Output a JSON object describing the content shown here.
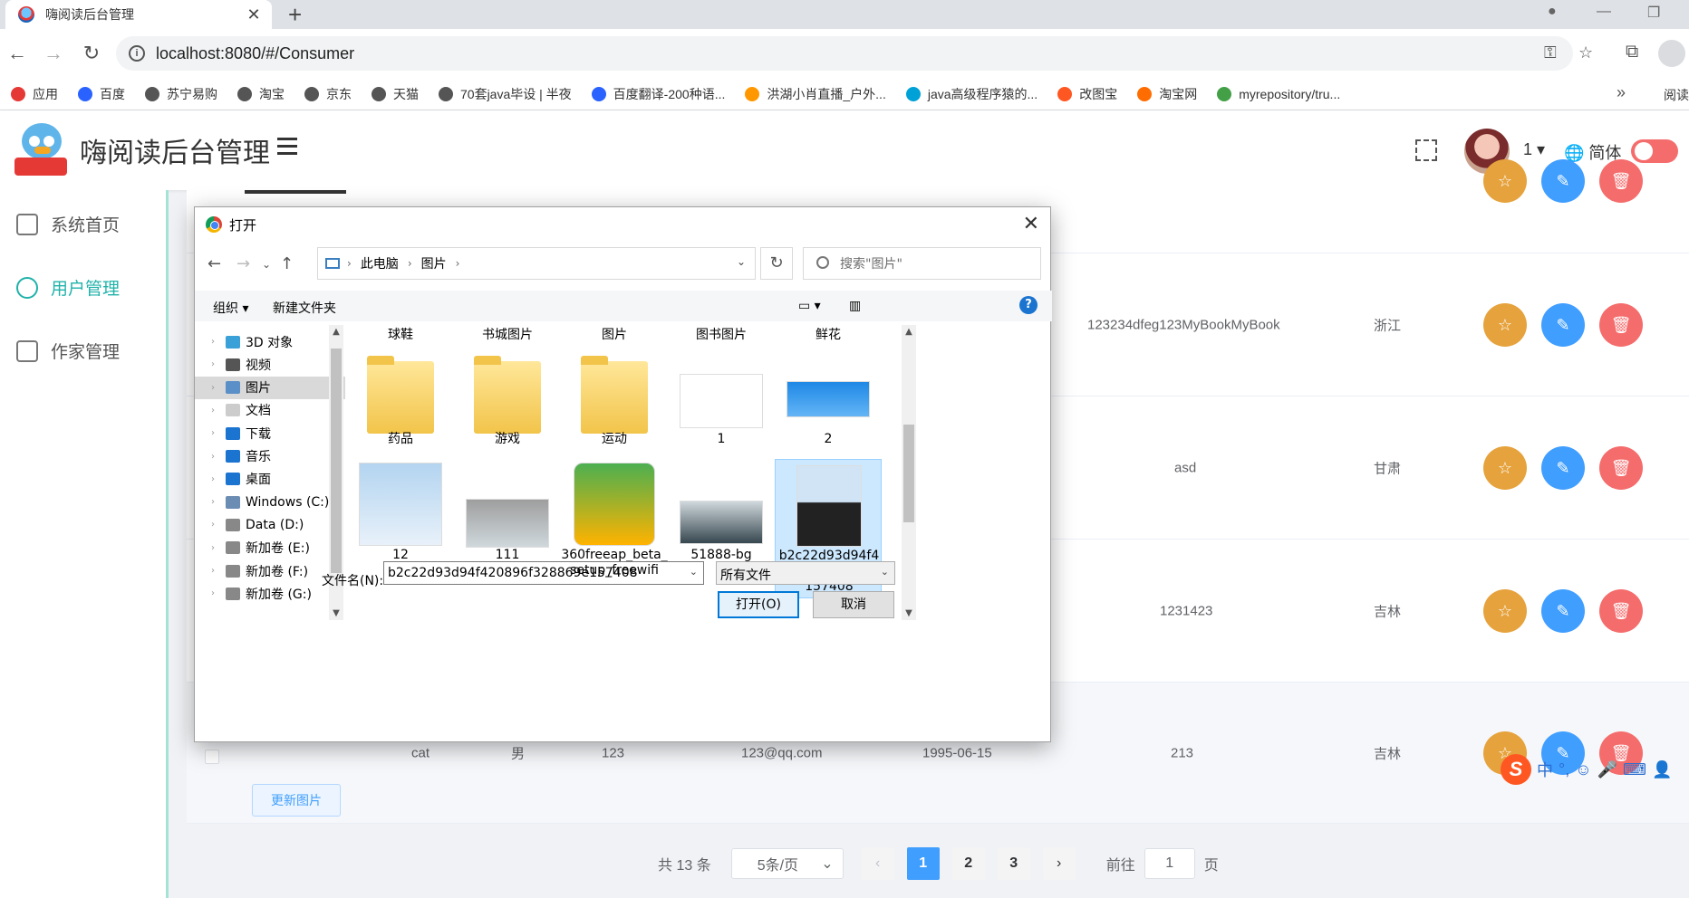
{
  "browser": {
    "tab_title": "嗨阅读后台管理",
    "url": "localhost:8080/#/Consumer",
    "bookmarks": [
      {
        "label": "应用",
        "color": "#e53935"
      },
      {
        "label": "百度",
        "color": "#2962ff"
      },
      {
        "label": "苏宁易购",
        "color": "#555555"
      },
      {
        "label": "淘宝",
        "color": "#555555"
      },
      {
        "label": "京东",
        "color": "#555555"
      },
      {
        "label": "天猫",
        "color": "#555555"
      },
      {
        "label": "70套java毕设 | 半夜",
        "color": "#555555"
      },
      {
        "label": "百度翻译-200种语...",
        "color": "#2962ff"
      },
      {
        "label": "洪湖小肖直播_户外...",
        "color": "#ff9800"
      },
      {
        "label": "java高级程序猿的...",
        "color": "#00a1d6"
      },
      {
        "label": "改图宝",
        "color": "#ff5722"
      },
      {
        "label": "淘宝网",
        "color": "#ff6d00"
      },
      {
        "label": "myrepository/tru...",
        "color": "#43a047"
      }
    ],
    "bookmark_more": "»",
    "reading_list": "阅读"
  },
  "header": {
    "title": "嗨阅读后台管理",
    "user_name": "1",
    "language": "简体"
  },
  "sidebar": {
    "items": [
      {
        "label": "系统首页",
        "icon": "home-icon"
      },
      {
        "label": "用户管理",
        "icon": "user-icon"
      },
      {
        "label": "作家管理",
        "icon": "pen-icon"
      }
    ]
  },
  "table": {
    "rows": [
      {
        "col_intro": "",
        "col_location": ""
      },
      {
        "col_intro": "123234dfeg123MyBookMyBook",
        "col_location": "浙江"
      },
      {
        "col_intro": "asd",
        "col_location": "甘肃"
      },
      {
        "col_intro": "1231423",
        "col_location": "吉林"
      },
      {
        "name": "cat",
        "sex": "男",
        "phone": "123",
        "email": "123@qq.com",
        "birth": "1995-06-15",
        "col_intro": "213",
        "col_location": "吉林"
      }
    ],
    "update_image_label": "更新图片"
  },
  "pagination": {
    "total": "共 13 条",
    "page_size": "5条/页",
    "pages": [
      "1",
      "2",
      "3"
    ],
    "active_page": "1",
    "goto_label": "前往",
    "goto_value": "1",
    "page_suffix": "页"
  },
  "ime": {
    "logo": "S",
    "mode": "中",
    "punct": "°,"
  },
  "dialog": {
    "title": "打开",
    "path": [
      "此电脑",
      "图片"
    ],
    "search_placeholder": "搜索\"图片\"",
    "organize_label": "组织 ▾",
    "new_folder_label": "新建文件夹",
    "tree": [
      {
        "label": "3D 对象",
        "color": "#3aa0d8"
      },
      {
        "label": "视频",
        "color": "#555555"
      },
      {
        "label": "图片",
        "color": "#5a8fc7",
        "selected": true
      },
      {
        "label": "文档",
        "color": "#cccccc"
      },
      {
        "label": "下载",
        "color": "#1b74d0"
      },
      {
        "label": "音乐",
        "color": "#1b74d0"
      },
      {
        "label": "桌面",
        "color": "#1b74d0"
      },
      {
        "label": "Windows (C:)",
        "color": "#6b8cb3"
      },
      {
        "label": "Data (D:)",
        "color": "#888888"
      },
      {
        "label": "新加卷 (E:)",
        "color": "#888888"
      },
      {
        "label": "新加卷 (F:)",
        "color": "#888888"
      },
      {
        "label": "新加卷 (G:)",
        "color": "#888888"
      }
    ],
    "top_row_labels": [
      "球鞋",
      "书城图片",
      "图片",
      "图书图片",
      "鲜花"
    ],
    "files": [
      {
        "label": "药品",
        "kind": "folder"
      },
      {
        "label": "游戏",
        "kind": "folder"
      },
      {
        "label": "运动",
        "kind": "folder"
      },
      {
        "label": "1",
        "kind": "java-logo"
      },
      {
        "label": "2",
        "kind": "java-banner"
      },
      {
        "label": "12",
        "kind": "mask-box"
      },
      {
        "label": "111",
        "kind": "mask"
      },
      {
        "label": "360freeap_beta_setup_freewifi",
        "kind": "installer"
      },
      {
        "label": "51888-bg",
        "kind": "photo"
      },
      {
        "label": "b2c22d93d94f420896f328869e157408",
        "kind": "portrait",
        "selected": true
      }
    ],
    "filename_label": "文件名(N):",
    "filename_value": "b2c22d93d94f420896f328869e157408",
    "filetype_value": "所有文件",
    "open_label": "打开(O)",
    "cancel_label": "取消",
    "help_glyph": "?"
  }
}
